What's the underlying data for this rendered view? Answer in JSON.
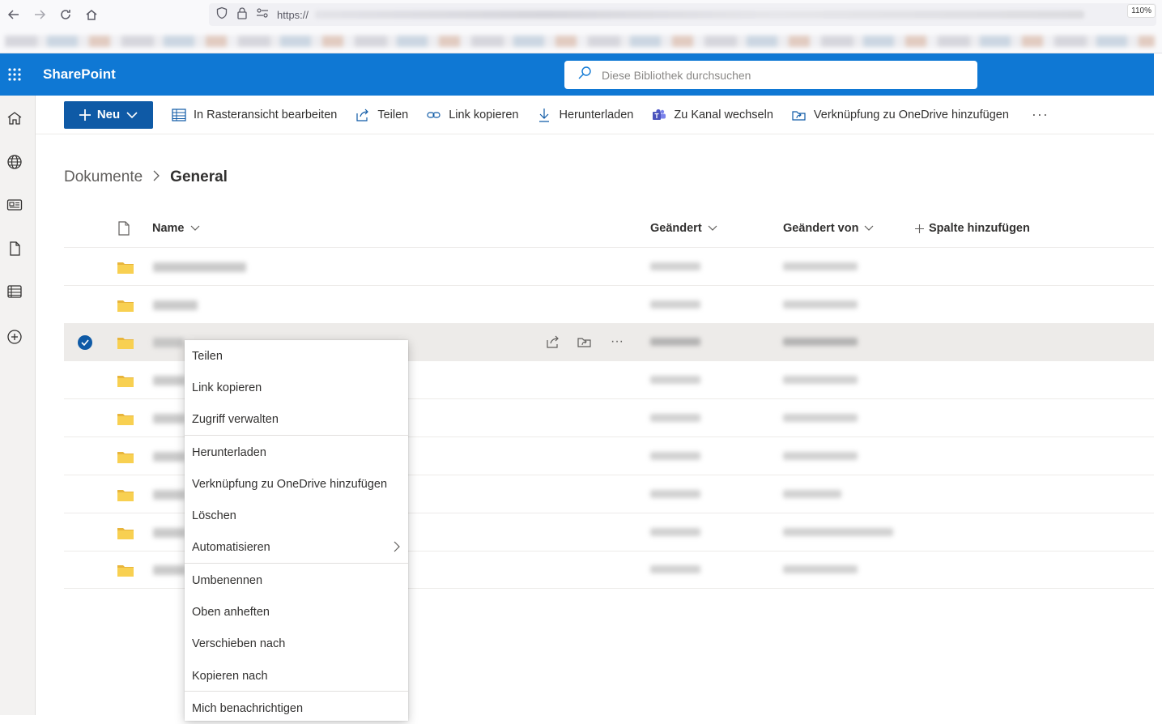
{
  "browser": {
    "url_prefix": "https://",
    "zoom": "110%",
    "icons": [
      "back-arrow-icon",
      "forward-arrow-icon",
      "reload-icon",
      "home-icon",
      "shield-icon",
      "lock-icon",
      "permissions-icon"
    ]
  },
  "suite": {
    "brand": "SharePoint",
    "search_placeholder": "Diese Bibliothek durchsuchen"
  },
  "commands": {
    "new_label": "Neu",
    "items": [
      {
        "label": "In Rasteransicht bearbeiten",
        "icon": "grid-icon"
      },
      {
        "label": "Teilen",
        "icon": "share-icon"
      },
      {
        "label": "Link kopieren",
        "icon": "link-icon"
      },
      {
        "label": "Herunterladen",
        "icon": "download-icon"
      },
      {
        "label": "Zu Kanal wechseln",
        "icon": "teams-icon"
      },
      {
        "label": "Verknüpfung zu OneDrive hinzufügen",
        "icon": "onedrive-shortcut-icon"
      }
    ],
    "more": "···"
  },
  "breadcrumb": {
    "parent": "Dokumente",
    "current": "General"
  },
  "columns": {
    "name": "Name",
    "modified": "Geändert",
    "modified_by": "Geändert von",
    "add_column": "Spalte hinzufügen"
  },
  "context_menu": {
    "items": [
      "Teilen",
      "Link kopieren",
      "Zugriff verwalten",
      "Herunterladen",
      "Verknüpfung zu OneDrive hinzufügen",
      "Löschen",
      "Automatisieren",
      "Umbenennen",
      "Oben anheften",
      "Verschieben nach",
      "Kopieren nach",
      "Mich benachrichtigen"
    ]
  },
  "colors": {
    "suite_blue": "#0f78d4",
    "primary_button": "#0f5aa6",
    "folder_yellow": "#f8d051",
    "selected_row": "#edebe9"
  }
}
